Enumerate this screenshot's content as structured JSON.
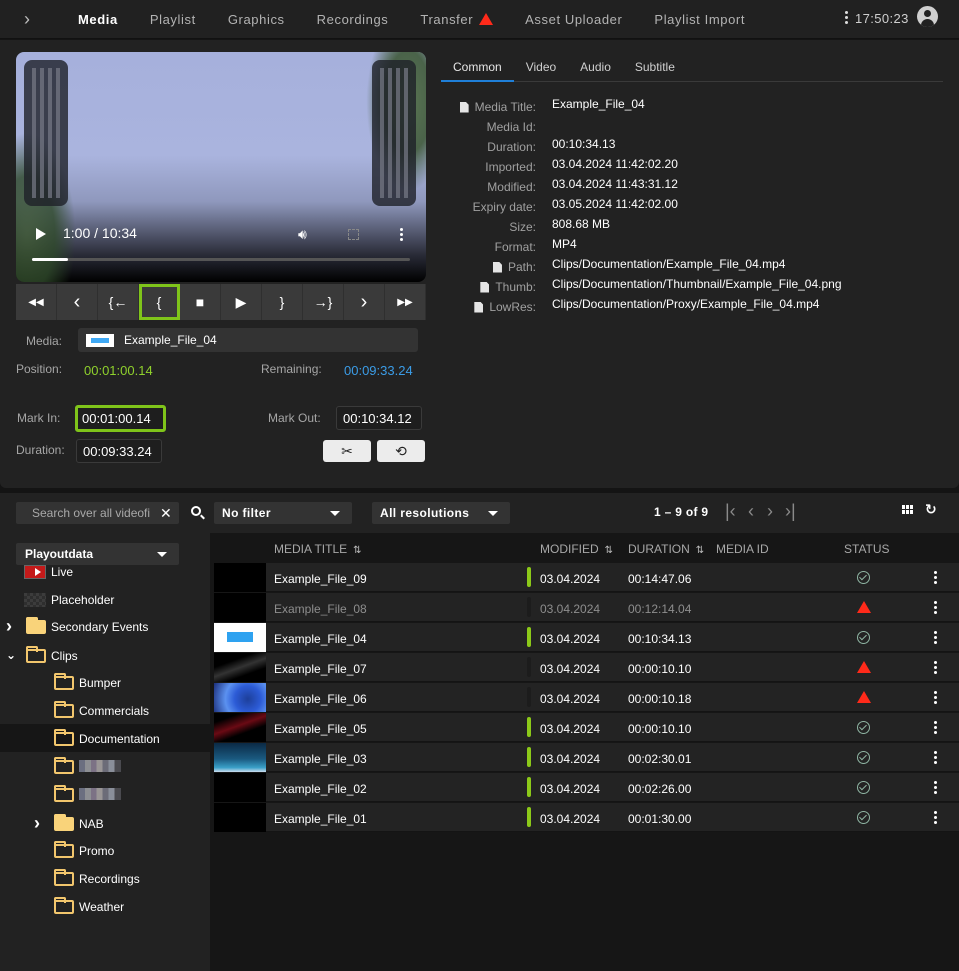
{
  "nav": {
    "tabs": [
      {
        "label": "Media",
        "active": true
      },
      {
        "label": "Playlist"
      },
      {
        "label": "Graphics"
      },
      {
        "label": "Recordings"
      },
      {
        "label": "Transfer",
        "warning": true
      },
      {
        "label": "Asset Uploader"
      },
      {
        "label": "Playlist Import"
      }
    ],
    "clock": "17:50:23"
  },
  "player": {
    "timecode": "1:00 / 10:34",
    "progress": 0.095
  },
  "transport": {
    "buttons": [
      {
        "name": "fast-rewind",
        "glyph": "◀◀"
      },
      {
        "name": "step-back",
        "glyph": "‹"
      },
      {
        "name": "goto-mark-in",
        "glyph": "{←"
      },
      {
        "name": "set-mark-in",
        "glyph": "{",
        "highlight": true
      },
      {
        "name": "stop",
        "glyph": "■"
      },
      {
        "name": "play",
        "glyph": "▶"
      },
      {
        "name": "set-mark-out",
        "glyph": "}"
      },
      {
        "name": "goto-mark-out",
        "glyph": "→}"
      },
      {
        "name": "step-forward",
        "glyph": "›"
      },
      {
        "name": "fast-forward",
        "glyph": "▶▶"
      }
    ]
  },
  "clip": {
    "media_label": "Media:",
    "media_name": "Example_File_04",
    "position_label": "Position:",
    "position": "00:01:00.14",
    "remaining_label": "Remaining:",
    "remaining": "00:09:33.24",
    "mark_in_label": "Mark In:",
    "mark_in": "00:01:00.14",
    "mark_out_label": "Mark Out:",
    "mark_out": "00:10:34.12",
    "duration_label": "Duration:",
    "duration": "00:09:33.24",
    "cut_glyph": "✂",
    "reset_glyph": "⟲"
  },
  "info": {
    "tabs": [
      "Common",
      "Video",
      "Audio",
      "Subtitle"
    ],
    "active_tab": "Common",
    "properties": [
      {
        "key": "Media Title:",
        "value": "Example_File_04",
        "icon": true
      },
      {
        "key": "Media Id:",
        "value": ""
      },
      {
        "key": "Duration:",
        "value": "00:10:34.13"
      },
      {
        "key": "Imported:",
        "value": "03.04.2024 11:42:02.20"
      },
      {
        "key": "Modified:",
        "value": "03.04.2024 11:43:31.12"
      },
      {
        "key": "Expiry date:",
        "value": "03.05.2024 11:42:02.00"
      },
      {
        "key": "Size:",
        "value": "808.68 MB"
      },
      {
        "key": "Format:",
        "value": "MP4"
      },
      {
        "key": "Path:",
        "value": "Clips/Documentation/Example_File_04.mp4",
        "icon": true
      },
      {
        "key": "Thumb:",
        "value": "Clips/Documentation/Thumbnail/Example_File_04.png",
        "icon": true
      },
      {
        "key": "LowRes:",
        "value": "Clips/Documentation/Proxy/Example_File_04.mp4",
        "icon": true
      }
    ]
  },
  "browser": {
    "search_placeholder": "Search over all videofi",
    "filter": "No filter",
    "resolution": "All resolutions",
    "pager": "1 – 9 of 9",
    "root": "Playoutdata",
    "tree": [
      {
        "label": "Live",
        "type": "live",
        "level": 0
      },
      {
        "label": "Placeholder",
        "type": "placeholder",
        "level": 0
      },
      {
        "label": "Secondary Events",
        "type": "folder-filled",
        "level": 0,
        "chevron": "›"
      },
      {
        "label": "Clips",
        "type": "folder",
        "level": 0,
        "chevron": "⌄"
      },
      {
        "label": "Bumper",
        "type": "folder",
        "level": 1
      },
      {
        "label": "Commercials",
        "type": "folder",
        "level": 1
      },
      {
        "label": "Documentation",
        "type": "folder",
        "level": 1,
        "selected": true
      },
      {
        "label": "",
        "type": "folder",
        "level": 1,
        "blurred": true
      },
      {
        "label": "",
        "type": "folder",
        "level": 1,
        "blurred": true
      },
      {
        "label": "NAB",
        "type": "folder-filled",
        "level": 1,
        "chevron": "›"
      },
      {
        "label": "Promo",
        "type": "folder",
        "level": 1
      },
      {
        "label": "Recordings",
        "type": "folder",
        "level": 1
      },
      {
        "label": "Weather",
        "type": "folder",
        "level": 1
      }
    ],
    "columns": [
      "MEDIA TITLE",
      "MODIFIED",
      "DURATION",
      "MEDIA ID",
      "STATUS"
    ],
    "rows": [
      {
        "title": "Example_File_09",
        "modified": "03.04.2024",
        "duration": "00:14:47.06",
        "status": "ok",
        "ready": true,
        "thumb": "black"
      },
      {
        "title": "Example_File_08",
        "modified": "03.04.2024",
        "duration": "00:12:14.04",
        "status": "warning",
        "ready": false,
        "dim": true,
        "thumb": "black"
      },
      {
        "title": "Example_File_04",
        "modified": "03.04.2024",
        "duration": "00:10:34.13",
        "status": "ok",
        "ready": true,
        "thumb": "bunny"
      },
      {
        "title": "Example_File_07",
        "modified": "03.04.2024",
        "duration": "00:00:10.10",
        "status": "warning",
        "ready": false,
        "thumb": "web"
      },
      {
        "title": "Example_File_06",
        "modified": "03.04.2024",
        "duration": "00:00:10.18",
        "status": "warning",
        "ready": false,
        "thumb": "earth"
      },
      {
        "title": "Example_File_05",
        "modified": "03.04.2024",
        "duration": "00:00:10.10",
        "status": "ok",
        "ready": true,
        "thumb": "red"
      },
      {
        "title": "Example_File_03",
        "modified": "03.04.2024",
        "duration": "00:02:30.01",
        "status": "ok",
        "ready": true,
        "thumb": "sky"
      },
      {
        "title": "Example_File_02",
        "modified": "03.04.2024",
        "duration": "00:02:26.00",
        "status": "ok",
        "ready": true,
        "thumb": "black"
      },
      {
        "title": "Example_File_01",
        "modified": "03.04.2024",
        "duration": "00:01:30.00",
        "status": "ok",
        "ready": true,
        "thumb": "black"
      }
    ]
  },
  "colors": {
    "accent_green": "#8cc919",
    "highlight_outline": "#7fc41a",
    "remaining_blue": "#3b9ce6",
    "warning_red": "#ff2a1a",
    "tab_underline": "#1f7fd8"
  }
}
